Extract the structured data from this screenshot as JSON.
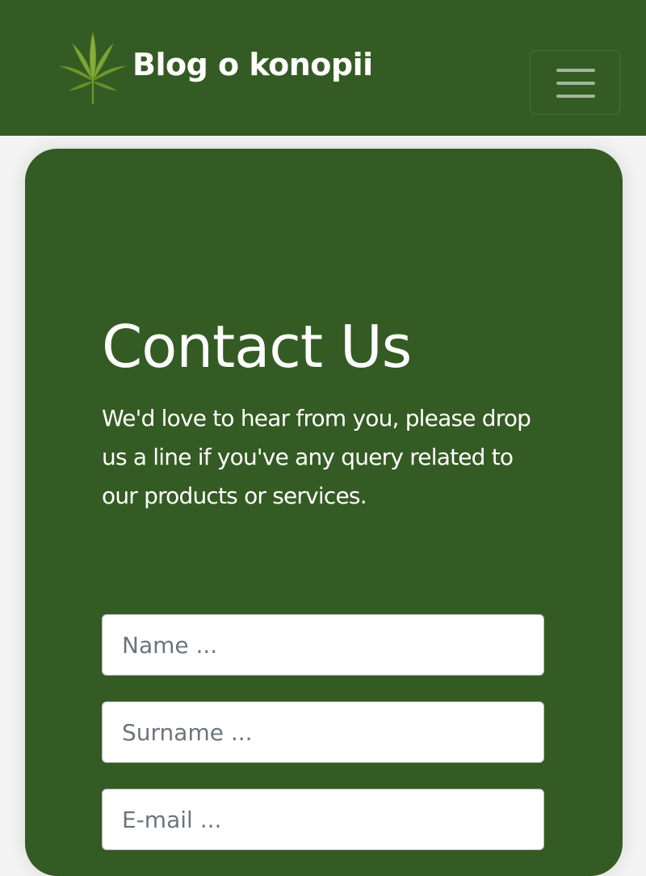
{
  "navbar": {
    "brand_text": "Blog o konopii",
    "logo_icon": "cannabis-leaf-icon",
    "toggler_icon": "hamburger-menu-icon",
    "background_color": "#345b23"
  },
  "contact": {
    "title": "Contact Us",
    "description": "We'd love to hear from you, please drop us a line if you've any query related to our products or services.",
    "card_color": "#345b23"
  },
  "form": {
    "name_placeholder": "Name ...",
    "surname_placeholder": "Surname ...",
    "email_placeholder": "E-mail ..."
  }
}
